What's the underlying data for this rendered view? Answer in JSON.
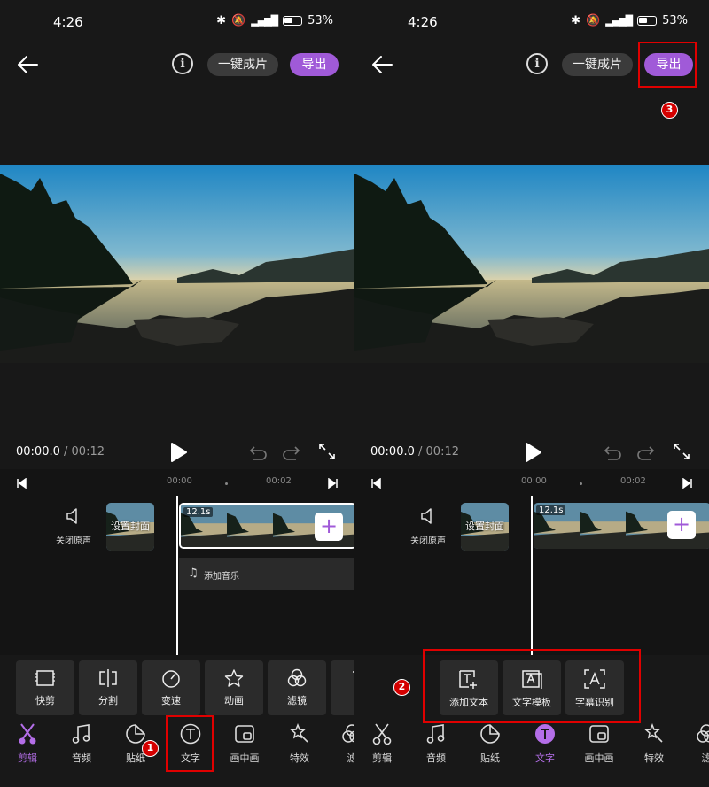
{
  "status_bar": {
    "time": "4:26",
    "battery": "53%",
    "network": "4G"
  },
  "header": {
    "info_icon": "i",
    "one_click_label": "一键成片",
    "export_label": "导出"
  },
  "player": {
    "current_time": "00:00.0",
    "separator": " / ",
    "total_time": "00:12"
  },
  "timeline": {
    "ruler_marks": [
      "00:00",
      "00:02"
    ],
    "mute_label": "关闭原声",
    "cover_label": "设置封面",
    "clip_duration": "12.1s",
    "add_clip_symbol": "+",
    "add_music_label": "添加音乐"
  },
  "left_tools": [
    {
      "label": "快剪",
      "icon": "crop-frame-icon"
    },
    {
      "label": "分割",
      "icon": "split-icon"
    },
    {
      "label": "变速",
      "icon": "speed-icon"
    },
    {
      "label": "动画",
      "icon": "star-icon"
    },
    {
      "label": "滤镜",
      "icon": "filter-icon"
    },
    {
      "label": "美",
      "icon": "beauty-icon"
    }
  ],
  "right_tools": [
    {
      "label": "添加文本",
      "icon": "add-text-icon"
    },
    {
      "label": "文字模板",
      "icon": "text-template-icon"
    },
    {
      "label": "字幕识别",
      "icon": "subtitle-recognize-icon"
    }
  ],
  "bottom_tabs": [
    {
      "label": "剪辑",
      "icon": "scissors-icon"
    },
    {
      "label": "音频",
      "icon": "music-icon"
    },
    {
      "label": "贴纸",
      "icon": "sticker-icon"
    },
    {
      "label": "文字",
      "icon": "text-icon"
    },
    {
      "label": "画中画",
      "icon": "pip-icon"
    },
    {
      "label": "特效",
      "icon": "effects-icon"
    },
    {
      "label": "滤",
      "icon": "filter-icon"
    }
  ],
  "left_active_tab": "剪辑",
  "right_active_tab": "文字",
  "annotations": {
    "step1": "1",
    "step2": "2",
    "step3": "3"
  },
  "colors": {
    "accent": "#a05ad8",
    "highlight": "#e00000",
    "background": "#181818"
  }
}
